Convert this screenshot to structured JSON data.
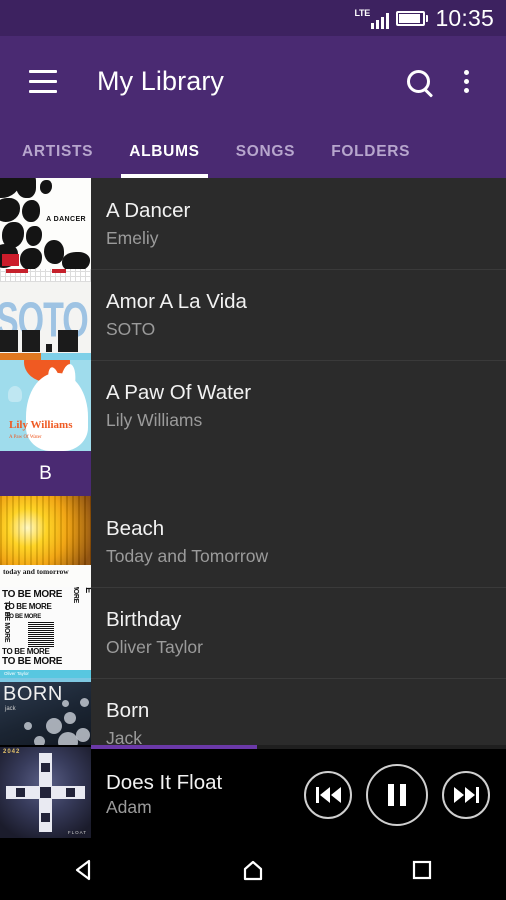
{
  "status_bar": {
    "network_label": "LTE",
    "time": "10:35",
    "icons": [
      "lte-signal-icon",
      "battery-icon"
    ]
  },
  "app_bar": {
    "title": "My Library",
    "menu_icon": "hamburger-menu-icon",
    "search_icon": "search-icon",
    "overflow_icon": "overflow-menu-icon"
  },
  "tabs": {
    "items": [
      {
        "label": "ARTISTS",
        "active": false
      },
      {
        "label": "ALBUMS",
        "active": true
      },
      {
        "label": "SONGS",
        "active": false
      },
      {
        "label": "FOLDERS",
        "active": false
      }
    ]
  },
  "list": {
    "rows": [
      {
        "type": "album",
        "title": "A Dancer",
        "artist": "Emeliy",
        "art": "dancer",
        "art_text": "A DANCER"
      },
      {
        "type": "album",
        "title": "Amor A La Vida",
        "artist": "SOTO",
        "art": "soto",
        "art_text": "SOTO"
      },
      {
        "type": "album",
        "title": "A Paw Of Water",
        "artist": "Lily Williams",
        "art": "lily",
        "art_text": "Lily Williams",
        "art_subtext": "A Paw Of Water"
      },
      {
        "type": "section",
        "letter": "B"
      },
      {
        "type": "album",
        "title": "Beach",
        "artist": "Today and Tomorrow",
        "art": "beach",
        "art_text": "today and tomorrow"
      },
      {
        "type": "album",
        "title": "Birthday",
        "artist": "Oliver Taylor",
        "art": "more",
        "art_text": "TO BE MORE"
      },
      {
        "type": "album",
        "title": "Born",
        "artist": "Jack",
        "art": "born",
        "art_text": "BORN"
      }
    ]
  },
  "player": {
    "title": "Does It Float",
    "artist": "Adam",
    "progress_percent": 40,
    "previous_icon": "skip-previous-icon",
    "play_pause_icon": "pause-icon",
    "next_icon": "skip-next-icon",
    "is_playing": true
  },
  "nav_bar": {
    "back_icon": "back-triangle-icon",
    "home_icon": "home-icon",
    "recents_icon": "recents-square-icon"
  },
  "colors": {
    "primary_purple": "#4a2a72",
    "status_purple": "#3d2260",
    "list_background": "#2b2b2b",
    "accent_progress": "#6b39a8",
    "title_text": "#f2f2f2",
    "secondary_text": "#9b9b9b"
  }
}
